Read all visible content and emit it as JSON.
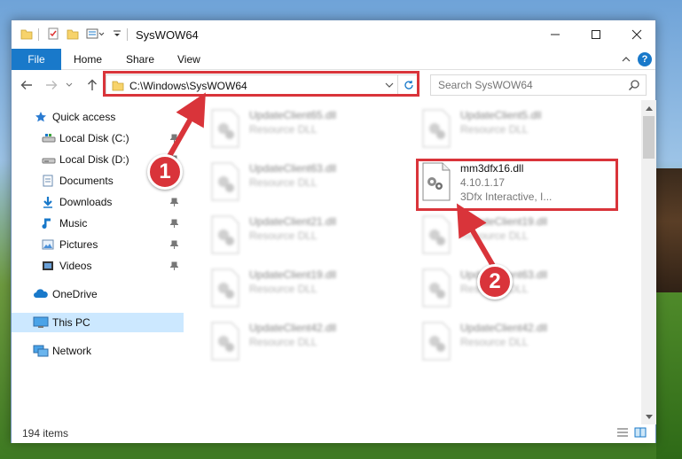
{
  "window": {
    "title": "SysWOW64",
    "quick_access_icons": [
      "folder-icon",
      "properties-icon",
      "new-folder-icon",
      "customize-icon"
    ],
    "controls": [
      "minimize-icon",
      "maximize-icon",
      "close-icon"
    ]
  },
  "ribbon": {
    "file_tab": "File",
    "tabs": [
      "Home",
      "Share",
      "View"
    ],
    "help": "?"
  },
  "nav": {
    "address": "C:\\Windows\\SysWOW64",
    "search_placeholder": "Search SysWOW64"
  },
  "sidebar": {
    "items": [
      {
        "label": "Quick access",
        "icon": "star-icon",
        "pinned": false
      },
      {
        "label": "Local Disk (C:)",
        "icon": "drive-icon",
        "pinned": true
      },
      {
        "label": "Local Disk (D:)",
        "icon": "drive-icon",
        "pinned": true
      },
      {
        "label": "Documents",
        "icon": "documents-icon",
        "pinned": true
      },
      {
        "label": "Downloads",
        "icon": "download-icon",
        "pinned": true
      },
      {
        "label": "Music",
        "icon": "music-icon",
        "pinned": true
      },
      {
        "label": "Pictures",
        "icon": "pictures-icon",
        "pinned": true
      },
      {
        "label": "Videos",
        "icon": "videos-icon",
        "pinned": true
      },
      {
        "label": "OneDrive",
        "icon": "cloud-icon",
        "pinned": false
      },
      {
        "label": "This PC",
        "icon": "computer-icon",
        "pinned": false,
        "selected": true
      },
      {
        "label": "Network",
        "icon": "network-icon",
        "pinned": false
      }
    ]
  },
  "files": [
    {
      "name": "UpdateClient65.dll",
      "desc": "Resource DLL",
      "blurred": true
    },
    {
      "name": "UpdateClient5.dll",
      "desc": "Resource DLL",
      "blurred": true
    },
    {
      "name": "UpdateClient63.dll",
      "desc": "Resource DLL",
      "blurred": true
    },
    {
      "name": "mm3dfx16.dll",
      "desc": "4.10.1.17",
      "company": "3Dfx Interactive, I...",
      "blurred": false
    },
    {
      "name": "UpdateClient21.dll",
      "desc": "Resource DLL",
      "blurred": true
    },
    {
      "name": "UpdateClient19.dll",
      "desc": "Resource DLL",
      "blurred": true
    },
    {
      "name": "UpdateClient19.dll",
      "desc": "Resource DLL",
      "blurred": true
    },
    {
      "name": "UpdateClient63.dll",
      "desc": "Resource DLL",
      "blurred": true
    },
    {
      "name": "UpdateClient42.dll",
      "desc": "Resource DLL",
      "blurred": true
    },
    {
      "name": "UpdateClient42.dll",
      "desc": "Resource DLL",
      "blurred": true
    }
  ],
  "status": {
    "item_count": "194 items"
  },
  "annotations": {
    "step1": "1",
    "step2": "2",
    "color": "#d9343a"
  }
}
